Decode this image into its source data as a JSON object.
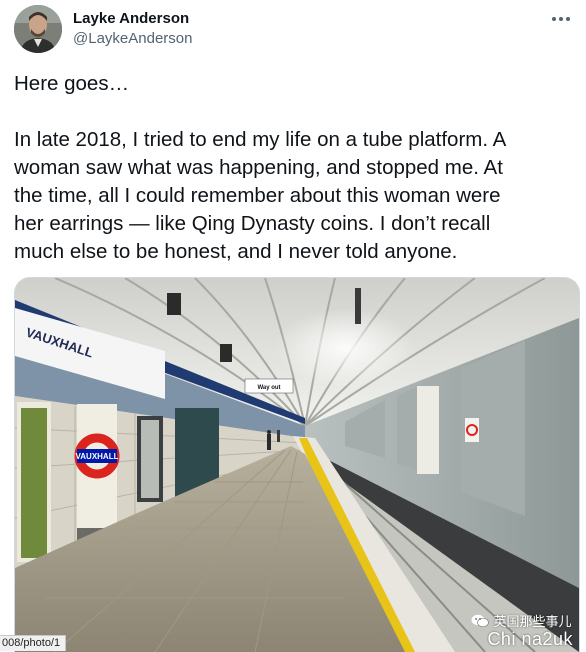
{
  "author": {
    "display_name": "Layke Anderson",
    "handle": "@LaykeAnderson"
  },
  "tweet": {
    "paragraphs": [
      "Here goes…",
      "In late 2018, I tried to end my life on a tube platform. A\nwoman saw what was happening, and stopped me. At\nthe time, all I could remember about this woman were\nher earrings — like Qing Dynasty coins. I don’t recall\nmuch else to be honest, and I never told anyone."
    ]
  },
  "photo": {
    "signs": {
      "wall_station_name": "VAUXHALL",
      "roundel_name": "VAUXHALL",
      "way_out": "Way out"
    }
  },
  "status_url": "008/photo/1",
  "watermark": {
    "line1": "英国那些事儿",
    "line2": "Chi na2uk"
  },
  "colors": {
    "text_primary": "#0f1419",
    "text_secondary": "#536471",
    "border": "#cfd9de",
    "roundel_red": "#dc241f",
    "roundel_blue": "#0019a8",
    "tactile_yellow": "#e8c419"
  },
  "icons": {
    "more": "more-horizontal-icon",
    "watermark": "wechat-icon"
  }
}
